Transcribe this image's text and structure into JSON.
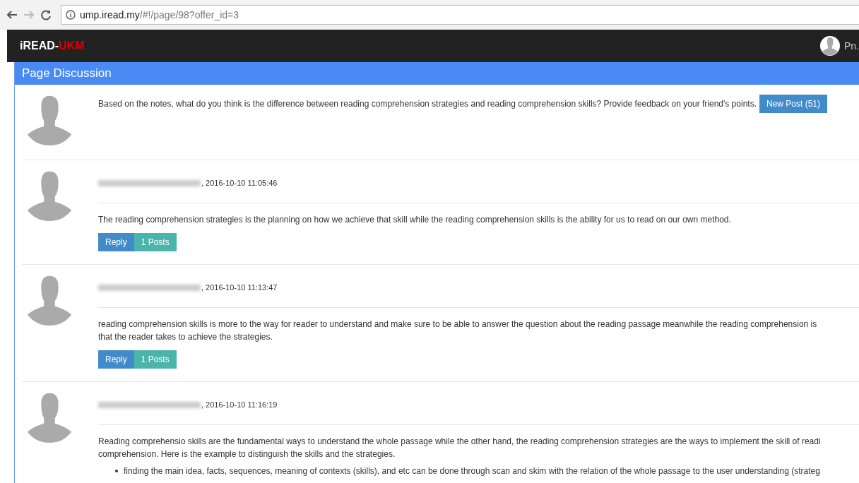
{
  "browser": {
    "back_disabled": false,
    "forward_disabled": true,
    "url_host": "ump.iread.my",
    "url_path": "/#!/page/98?offer_id=3"
  },
  "navbar": {
    "brand": "iREAD-",
    "brand_accent": "UKM",
    "user": "Pn."
  },
  "panel": {
    "title": "Page Discussion",
    "question": {
      "text": "Based on the notes, what do you think is the difference between reading comprehension strategies and reading comprehension skills? Provide feedback on your friend's points.",
      "button": "New Post (51)"
    },
    "posts": [
      {
        "meta": ", 2016-10-10 11:05:46",
        "lines": [
          "The reading comprehension strategies is the planning on how we achieve that skill while the reading comprehension skills is the ability for us to read on our own method."
        ],
        "reply": "Reply",
        "count": "1 Posts"
      },
      {
        "meta": ", 2016-10-10 11:13:47",
        "lines": [
          "reading comprehension skills is more to the way for reader to understand and make sure to be able to answer the question about  the reading passage meanwhile the reading comprehension is",
          "that the reader takes to achieve the strategies."
        ],
        "reply": "Reply",
        "count": "1 Posts"
      },
      {
        "meta": ", 2016-10-10 11:16:19",
        "lines": [
          "Reading comprehensio skills are the fundamental ways to understand the whole passage while the other hand, the reading comprehension strategies are the ways to implement the skill of readi",
          "comprehension. Here is the example to distinguish the skills and the strategies."
        ],
        "bullets": [
          "finding the main idea, facts, sequences, meaning of contexts (skills), and etc can be done through scan and skim with the relation of the whole passage to the user understanding (strateg"
        ]
      }
    ]
  }
}
